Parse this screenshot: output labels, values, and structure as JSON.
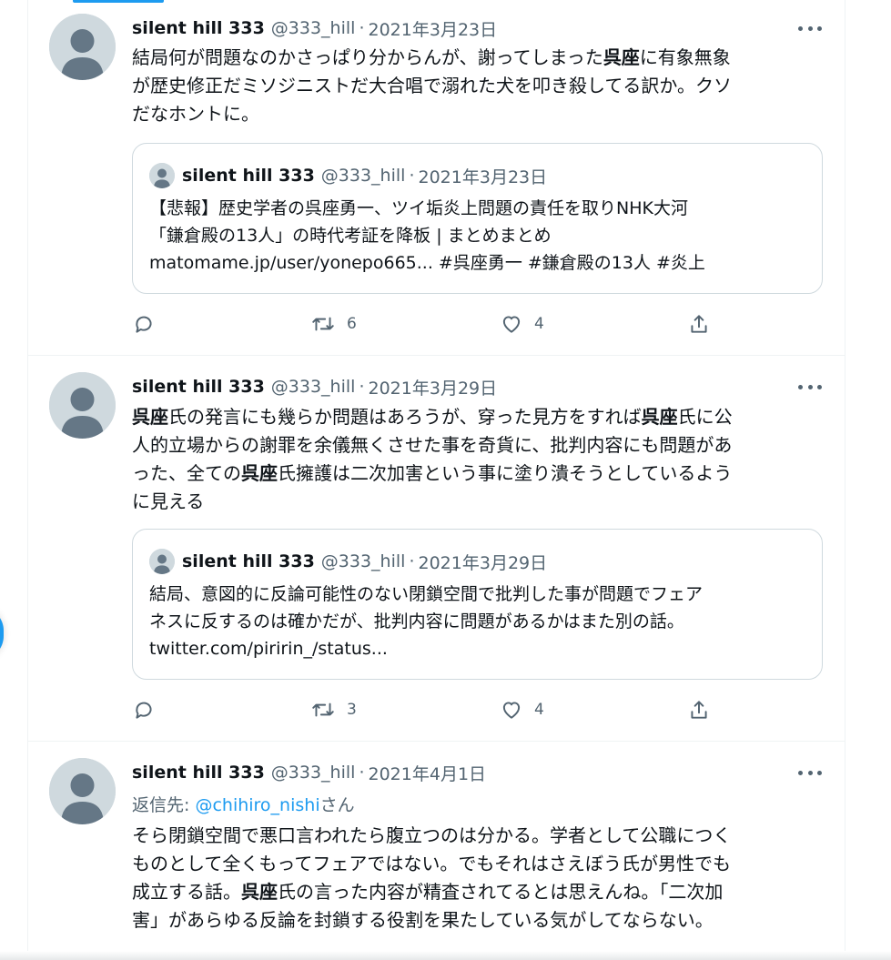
{
  "tweets": [
    {
      "name": "silent hill 333",
      "handle": "@333_hill",
      "date": "2021年3月23日",
      "body": [
        [
          {
            "t": "結局何が問題なのかさっぱり分からんが、謝ってしまった"
          },
          {
            "t": "呉座",
            "b": true
          },
          {
            "t": "に有象無象"
          }
        ],
        [
          {
            "t": "が歴史修正だミソジニストだ大合唱で溺れた犬を叩き殺してる訳か。クソ"
          }
        ],
        [
          {
            "t": "だなホントに。"
          }
        ]
      ],
      "quote": {
        "name": "silent hill 333",
        "handle": "@333_hill",
        "date": "2021年3月23日",
        "lines": [
          "【悲報】歴史学者の呉座勇一、ツイ垢炎上問題の責任を取りNHK大河",
          "「鎌倉殿の13人」の時代考証を降板 | まとめまとめ",
          "matomame.jp/user/yonepo665... #呉座勇一 #鎌倉殿の13人 #炎上"
        ]
      },
      "retweets": "6",
      "likes": "4"
    },
    {
      "name": "silent hill 333",
      "handle": "@333_hill",
      "date": "2021年3月29日",
      "body": [
        [
          {
            "t": "呉座",
            "b": true
          },
          {
            "t": "氏の発言にも幾らか問題はあろうが、穿った見方をすれば"
          },
          {
            "t": "呉座",
            "b": true
          },
          {
            "t": "氏に公"
          }
        ],
        [
          {
            "t": "人的立場からの謝罪を余儀無くさせた事を奇貨に、批判内容にも問題があ"
          }
        ],
        [
          {
            "t": "った、全ての"
          },
          {
            "t": "呉座",
            "b": true
          },
          {
            "t": "氏擁護は二次加害という事に塗り潰そうとしているよう"
          }
        ],
        [
          {
            "t": "に見える"
          }
        ]
      ],
      "quote": {
        "name": "silent hill 333",
        "handle": "@333_hill",
        "date": "2021年3月29日",
        "lines": [
          "結局、意図的に反論可能性のない閉鎖空間で批判した事が問題でフェア",
          "ネスに反するのは確かだが、批判内容に問題があるかはまた別の話。",
          "twitter.com/piririn_/status..."
        ]
      },
      "retweets": "3",
      "likes": "4"
    },
    {
      "name": "silent hill 333",
      "handle": "@333_hill",
      "date": "2021年4月1日",
      "reply_prefix": "返信先: ",
      "reply_handle": "@chihiro_nishi",
      "reply_suffix": "さん",
      "body": [
        [
          {
            "t": "そら閉鎖空間で悪口言われたら腹立つのは分かる。学者として公職につく"
          }
        ],
        [
          {
            "t": "ものとして全くもってフェアではない。でもそれはさえぼう氏が男性でも"
          }
        ],
        [
          {
            "t": "成立する話。"
          },
          {
            "t": "呉座",
            "b": true
          },
          {
            "t": "氏の言った内容が精査されてるとは思えんね。「二次加"
          }
        ],
        [
          {
            "t": "害」があらゆる反論を封鎖する役割を果たしている気がしてならない。"
          }
        ]
      ]
    }
  ]
}
